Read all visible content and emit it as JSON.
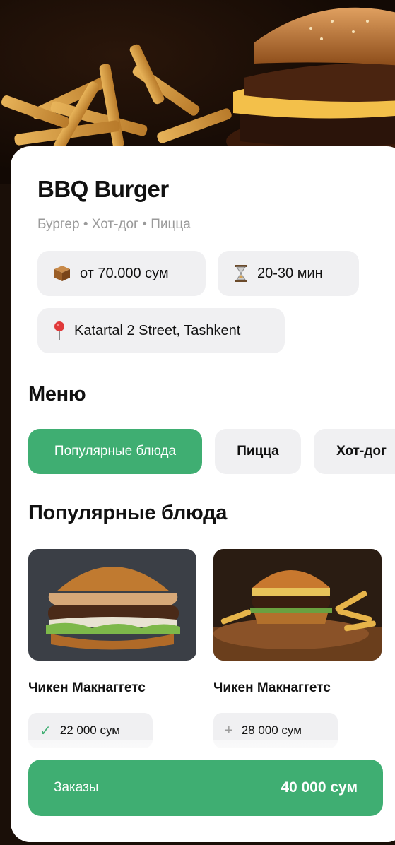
{
  "restaurant": {
    "name": "BBQ Burger",
    "categories_line": "Бургер • Хот-дог • Пицца",
    "min_order": "от 70.000 сум",
    "delivery_time": "20-30 мин",
    "address": "Katartal 2 Street, Tashkent"
  },
  "menu": {
    "title": "Меню",
    "tabs": [
      {
        "label": "Популярные блюда",
        "active": true
      },
      {
        "label": "Пицца",
        "active": false
      },
      {
        "label": "Хот-дог",
        "active": false
      }
    ]
  },
  "popular": {
    "title": "Популярные блюда",
    "items": [
      {
        "name": "Чикен Макнаггетс",
        "price": "22 000 сум",
        "state": "added",
        "icon": "check-icon"
      },
      {
        "name": "Чикен Макнаггетс",
        "price": "28 000 сум",
        "state": "not-added",
        "icon": "plus-icon"
      }
    ]
  },
  "order": {
    "label": "Заказы",
    "total": "40 000 сум"
  },
  "icons": {
    "min_order": "package-icon",
    "delivery_time": "hourglass-icon",
    "address": "location-pin-icon"
  },
  "colors": {
    "accent": "#3fae72",
    "chip_bg": "#f0f0f2",
    "muted_text": "#9a9a9a"
  }
}
